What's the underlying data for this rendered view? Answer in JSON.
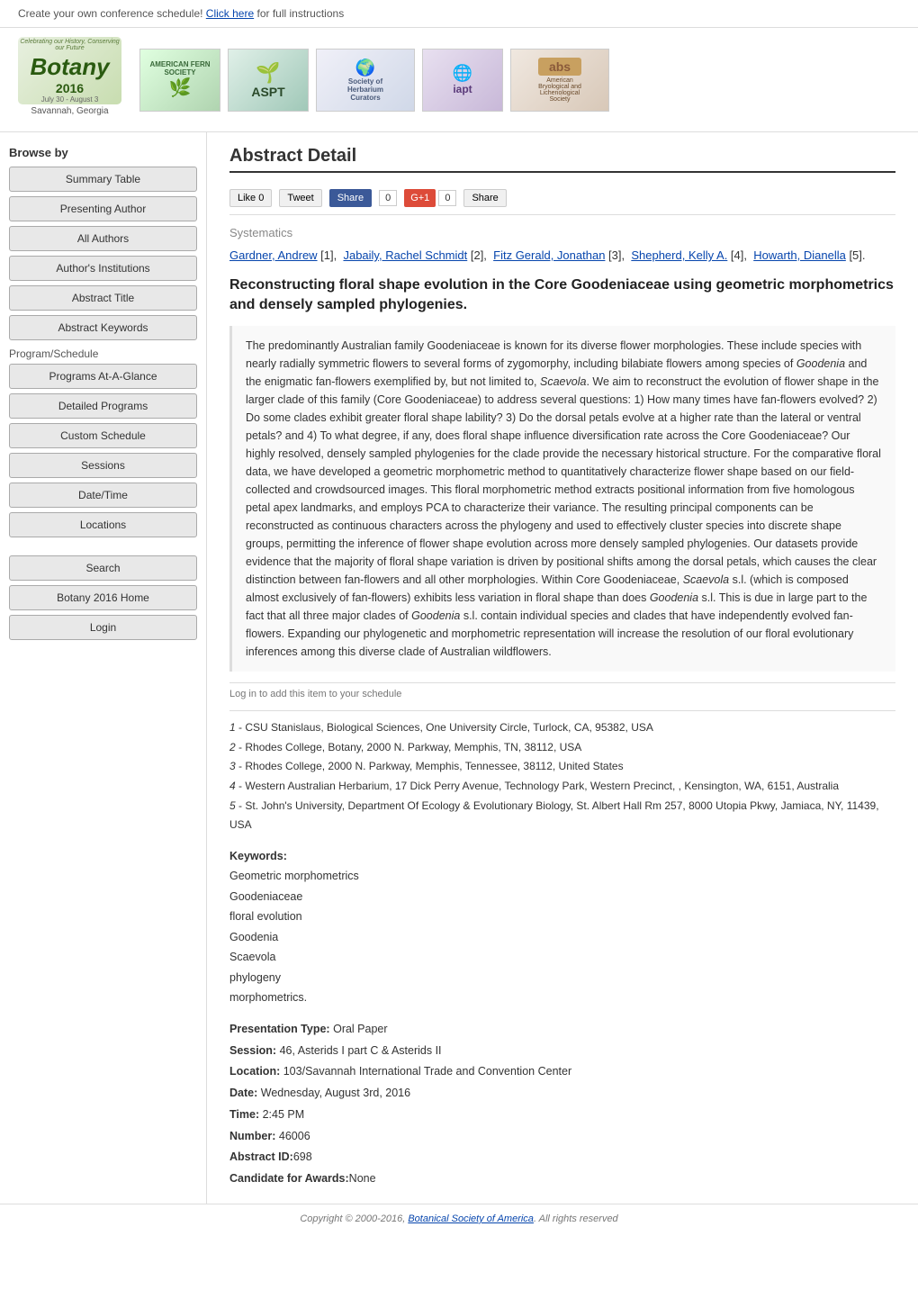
{
  "topBanner": {
    "text": "Create your own conference schedule! ",
    "linkText": "Click here",
    "suffix": " for full instructions"
  },
  "header": {
    "botanyLogo": {
      "topText": "Celebrating our History, Conserving our Future",
      "mainText": "Botany",
      "yearText": "2016",
      "dateText": "July 30 - August 3",
      "locationText": "Savannah, Georgia"
    },
    "sponsors": [
      {
        "name": "American Fern Society",
        "abbr": "AMERICAN FERN SOCIETY",
        "type": "fern"
      },
      {
        "name": "ASPT",
        "abbr": "ASPT",
        "type": "aspt"
      },
      {
        "name": "Society of Herbarium Curators",
        "abbr": "Society of Herbarium Curators",
        "type": "shc"
      },
      {
        "name": "IAPT",
        "abbr": "iapt",
        "type": "iapt"
      },
      {
        "name": "American Bryological and Lichenological Society",
        "abbr": "abs",
        "type": "abs"
      }
    ]
  },
  "sidebar": {
    "browseByLabel": "Browse by",
    "buttons": [
      {
        "id": "summary-table",
        "label": "Summary Table"
      },
      {
        "id": "presenting-author",
        "label": "Presenting Author"
      },
      {
        "id": "all-authors",
        "label": "All Authors"
      },
      {
        "id": "authors-institutions",
        "label": "Author's Institutions"
      },
      {
        "id": "abstract-title",
        "label": "Abstract Title"
      },
      {
        "id": "abstract-keywords",
        "label": "Abstract Keywords"
      }
    ],
    "programScheduleLabel": "Program/Schedule",
    "programButtons": [
      {
        "id": "programs-at-a-glance",
        "label": "Programs At-A-Glance"
      },
      {
        "id": "detailed-programs",
        "label": "Detailed Programs"
      },
      {
        "id": "custom-schedule",
        "label": "Custom Schedule"
      },
      {
        "id": "sessions",
        "label": "Sessions"
      },
      {
        "id": "date-time",
        "label": "Date/Time"
      },
      {
        "id": "locations",
        "label": "Locations"
      }
    ],
    "bottomButtons": [
      {
        "id": "search",
        "label": "Search"
      },
      {
        "id": "botany-home",
        "label": "Botany 2016 Home"
      },
      {
        "id": "login",
        "label": "Login"
      }
    ]
  },
  "content": {
    "pageTitle": "Abstract Detail",
    "social": {
      "likeLabel": "Like 0",
      "tweetLabel": "Tweet",
      "shareLabel": "Share",
      "shareCount": "0",
      "gplusLabel": "G+1",
      "gplusCount": "0",
      "shareLabel2": "Share"
    },
    "sectionLabel": "Systematics",
    "authors": [
      {
        "name": "Gardner, Andrew",
        "num": "1"
      },
      {
        "name": "Jabaily, Rachel Schmidt",
        "num": "2"
      },
      {
        "name": "Fitz Gerald, Jonathan",
        "num": "3"
      },
      {
        "name": "Shepherd, Kelly A.",
        "num": "4"
      },
      {
        "name": "Howarth, Dianella",
        "num": "5"
      }
    ],
    "abstractTitle": "Reconstructing floral shape evolution in the Core Goodeniaceae using geometric morphometrics and densely sampled phylogenies.",
    "abstractBody": "The predominantly Australian family Goodeniaceae is known for its diverse flower morphologies. These include species with nearly radially symmetric flowers to several forms of zygomorphy, including bilabiate flowers among species of Goodenia and the enigmatic fan-flowers exemplified by, but not limited to, Scaevola. We aim to reconstruct the evolution of flower shape in the larger clade of this family (Core Goodeniaceae) to address several questions: 1) How many times have fan-flowers evolved? 2) Do some clades exhibit greater floral shape lability? 3) Do the dorsal petals evolve at a higher rate than the lateral or ventral petals? and 4) To what degree, if any, does floral shape influence diversification rate across the Core Goodeniaceae? Our highly resolved, densely sampled phylogenies for the clade provide the necessary historical structure. For the comparative floral data, we have developed a geometric morphometric method to quantitatively characterize flower shape based on our field-collected and crowdsourced images. This floral morphometric method extracts positional information from five homologous petal apex landmarks, and employs PCA to characterize their variance. The resulting principal components can be reconstructed as continuous characters across the phylogeny and used to effectively cluster species into discrete shape groups, permitting the inference of flower shape evolution across more densely sampled phylogenies. Our datasets provide evidence that the majority of floral shape variation is driven by positional shifts among the dorsal petals, which causes the clear distinction between fan-flowers and all other morphologies. Within Core Goodeniaceae, Scaevola s.l. (which is composed almost exclusively of fan-flowers) exhibits less variation in floral shape than does Goodenia s.l. This is due in large part to the fact that all three major clades of Goodenia s.l. contain individual species and clades that have independently evolved fan-flowers. Expanding our phylogenetic and morphometric representation will increase the resolution of our floral evolutionary inferences among this diverse clade of Australian wildflowers.",
    "scheduleNote": "Log in to add this item to your schedule",
    "affiliations": [
      {
        "num": "1",
        "text": "CSU Stanislaus, Biological Sciences, One University Circle, Turlock, CA, 95382, USA"
      },
      {
        "num": "2",
        "text": "Rhodes College, Botany, 2000 N. Parkway, Memphis, TN, 38112, USA"
      },
      {
        "num": "3",
        "text": "Rhodes College, 2000 N. Parkway, Memphis, Tennessee, 38112, United States"
      },
      {
        "num": "4",
        "text": "Western Australian Herbarium, 17 Dick Perry Avenue, Technology Park, Western Precinct, , Kensington, WA, 6151, Australia"
      },
      {
        "num": "5",
        "text": "St. John's University, Department Of Ecology & Evolutionary Biology, St. Albert Hall Rm 257, 8000 Utopia Pkwy, Jamiaca, NY, 11439, USA"
      }
    ],
    "keywords": {
      "label": "Keywords:",
      "items": [
        "Geometric morphometrics",
        "Goodeniaceae",
        "floral evolution",
        "Goodenia",
        "Scaevola",
        "phylogeny",
        "morphometrics."
      ]
    },
    "presentationInfo": {
      "typeLabel": "Presentation Type:",
      "typeValue": "Oral Paper",
      "sessionLabel": "Session:",
      "sessionValue": "46, Asterids I part C & Asterids II",
      "locationLabel": "Location:",
      "locationValue": "103/Savannah International Trade and Convention Center",
      "dateLabel": "Date:",
      "dateValue": "Wednesday, August 3rd, 2016",
      "timeLabel": "Time:",
      "timeValue": "2:45 PM",
      "numberLabel": "Number:",
      "numberValue": "46006",
      "abstractIdLabel": "Abstract ID:",
      "abstractIdValue": "698",
      "candidateLabel": "Candidate for Awards:",
      "candidateValue": "None"
    }
  },
  "footer": {
    "text": "Copyright © 2000-2016, ",
    "linkText": "Botanical Society of America",
    "suffix": ". All rights reserved"
  }
}
